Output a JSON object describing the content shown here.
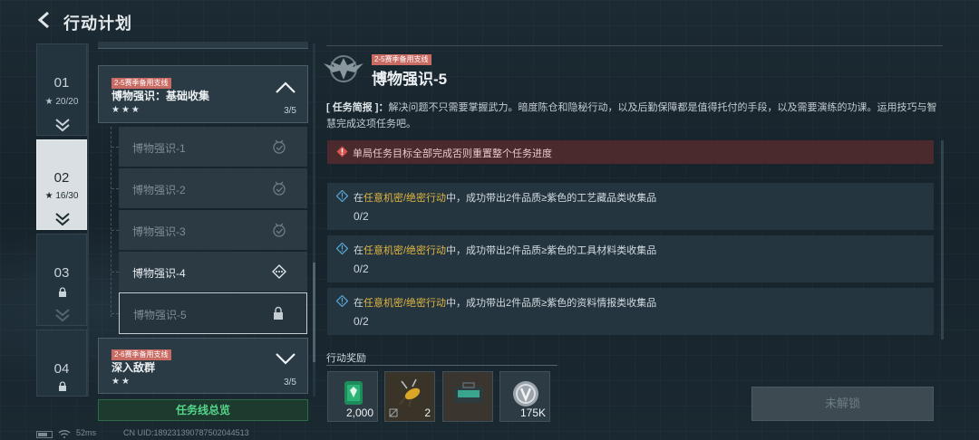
{
  "header": {
    "title": "行动计划"
  },
  "chapters": [
    {
      "num": "01",
      "progress": "20/20",
      "state": "unlocked"
    },
    {
      "num": "02",
      "progress": "16/30",
      "state": "active"
    },
    {
      "num": "03",
      "progress": "",
      "state": "locked"
    },
    {
      "num": "04",
      "progress": "",
      "state": "locked"
    }
  ],
  "mission_groups": [
    {
      "tag": "2-5赛季备用支线",
      "title": "博物强识：基础收集",
      "stars": "★★★",
      "progress": "3/5",
      "expanded": true
    },
    {
      "tag": "2-6赛季备用支线",
      "title": "深入敌群",
      "stars": "★★",
      "progress": "3/5",
      "expanded": false
    }
  ],
  "sub_missions": [
    {
      "label": "博物强识-1",
      "status": "completed"
    },
    {
      "label": "博物强识-2",
      "status": "completed"
    },
    {
      "label": "博物强识-3",
      "status": "completed"
    },
    {
      "label": "博物强识-4",
      "status": "in-progress"
    },
    {
      "label": "博物强识-5",
      "status": "locked"
    }
  ],
  "overview_button": "任务线总览",
  "detail": {
    "tag": "2-5赛季备用支线",
    "title": "博物强识-5",
    "brief_label": "[ 任务简报 ]：",
    "brief_text": "解决问题不只需要掌握武力。暗度陈仓和隐秘行动，以及后勤保障都是值得托付的手段，以及需要演练的功课。运用技巧与智慧完成这项任务吧。",
    "warning": "单局任务目标全部完成否则重置整个任务进度",
    "objectives": [
      {
        "prefix": "在",
        "highlight": "任意机密/绝密行动",
        "suffix": "中，成功带出2件品质≥紫色的工艺藏品类收集品",
        "progress": "0/2"
      },
      {
        "prefix": "在",
        "highlight": "任意机密/绝密行动",
        "suffix": "中，成功带出2件品质≥紫色的工具材料类收集品",
        "progress": "0/2"
      },
      {
        "prefix": "在",
        "highlight": "任意机密/绝密行动",
        "suffix": "中，成功带出2件品质≥紫色的资料情报类收集品",
        "progress": "0/2"
      }
    ],
    "rewards_label": "行动奖励",
    "rewards": [
      {
        "icon": "green-token-icon",
        "qty": "2,000"
      },
      {
        "icon": "bee-item-icon",
        "qty": "2"
      },
      {
        "icon": "equipment-case-icon",
        "qty": ""
      },
      {
        "icon": "silver-coin-icon",
        "qty": "175K"
      }
    ],
    "locked_button": "未解锁"
  },
  "footer": {
    "ping": "52ms",
    "uid": "CN UID:1892313907875020445​13"
  },
  "colors": {
    "accent_green": "#55d58a",
    "highlight": "#e0b640",
    "warning_bg": "#4a2a2c",
    "tag_red": "#c96a63"
  }
}
